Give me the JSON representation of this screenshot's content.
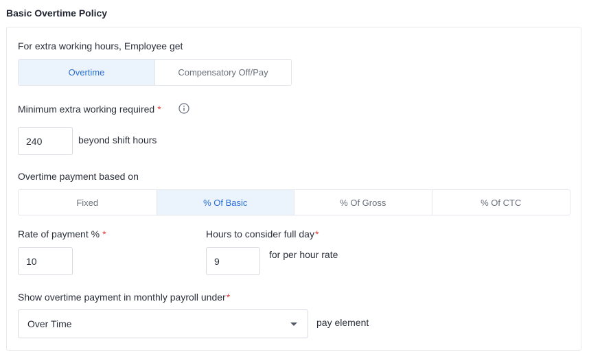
{
  "page": {
    "title": "Basic Overtime Policy"
  },
  "extra_hours": {
    "label": "For extra working hours, Employee get",
    "options": [
      "Overtime",
      "Compensatory Off/Pay"
    ],
    "selected": "Overtime"
  },
  "minimum_extra": {
    "label": "Minimum extra working required",
    "required_mark": "*",
    "value": "240",
    "suffix": "beyond shift hours",
    "info_icon": "info-icon"
  },
  "payment_basis": {
    "label": "Overtime payment based on",
    "options": [
      "Fixed",
      "% Of Basic",
      "% Of Gross",
      "% Of CTC"
    ],
    "selected": "% Of Basic"
  },
  "rate": {
    "label": "Rate of payment %",
    "required_mark": "*",
    "value": "10"
  },
  "full_day": {
    "label": "Hours to consider full day",
    "required_mark": "*",
    "value": "9",
    "suffix": "for per hour rate"
  },
  "payroll": {
    "label": "Show overtime payment in monthly payroll under",
    "required_mark": "*",
    "selected": "Over Time",
    "suffix": "pay element",
    "caret_icon": "caret-down-icon"
  },
  "colors": {
    "accent": "#2a6fd1",
    "active_bg": "#ebf3fd",
    "required": "#e0403a",
    "border": "#e3e6ea"
  }
}
